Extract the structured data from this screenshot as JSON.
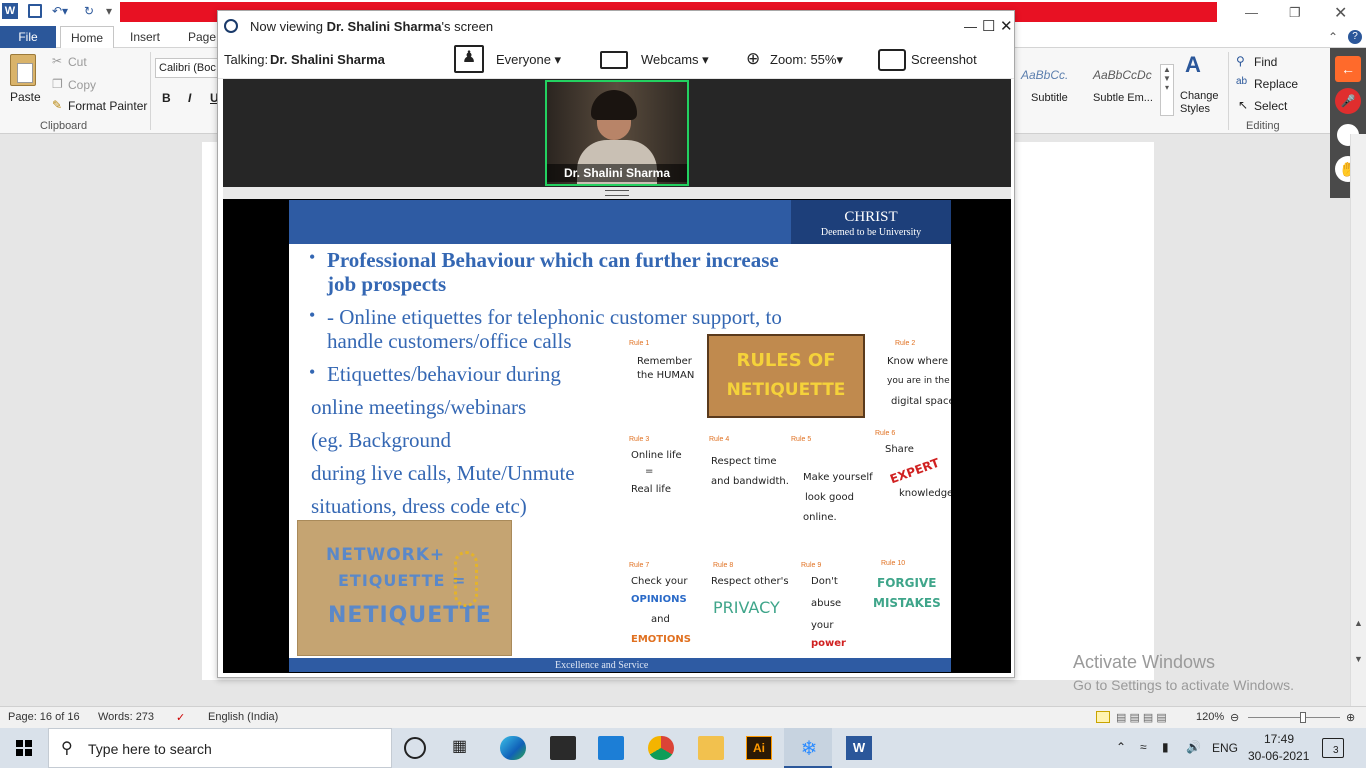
{
  "word": {
    "title_tab_file": "File",
    "tabs": [
      "Home",
      "Insert",
      "Page"
    ],
    "clipboard": {
      "paste": "Paste",
      "cut": "Cut",
      "copy": "Copy",
      "format_painter": "Format Painter",
      "group_label": "Clipboard"
    },
    "font_name": "Calibri (Boc",
    "styles": [
      {
        "preview": "AaBbCc.",
        "name": "Subtitle"
      },
      {
        "preview": "AaBbCcDc",
        "name": "Subtle Em..."
      }
    ],
    "change_styles": [
      "Change",
      "Styles"
    ],
    "editing": {
      "find": "Find",
      "replace": "Replace",
      "select": "Select",
      "group_label": "Editing"
    },
    "status": {
      "page": "Page: 16 of 16",
      "words": "Words: 273",
      "language": "English (India)",
      "zoom": "120%",
      "zoom_fraction": 0.6
    },
    "activate": {
      "line1": "Activate Windows",
      "line2": "Go to Settings to activate Windows."
    }
  },
  "zoom_window": {
    "title_prefix": "Now viewing ",
    "title_name": "Dr. Shalini  Sharma",
    "title_suffix": "'s screen",
    "talking_label": "Talking:",
    "talking_name": "Dr. Shalini  Sharma",
    "everyone": "Everyone",
    "webcams": "Webcams",
    "zoom_level": "Zoom: 55%",
    "screenshot": "Screenshot",
    "video_name": "Dr. Shalini  Sharma"
  },
  "slide": {
    "logo_name": "CHRIST",
    "logo_sub": "Deemed to be University",
    "bullets": [
      {
        "lines": [
          "Professional Behaviour which can further increase",
          "job prospects"
        ]
      },
      {
        "lines": [
          "- Online etiquettes for telephonic customer support, to",
          "handle customers/office calls"
        ]
      },
      {
        "lines": [
          "Etiquettes/behaviour during",
          "online meetings/webinars",
          "(eg. Background",
          "during live calls, Mute/Unmute",
          "situations, dress code etc)"
        ]
      }
    ],
    "netiquette_box": {
      "line1": "NETWORK+",
      "line2": "ETIQUETTE =",
      "line3": "NETIQUETTE"
    },
    "rules_title": [
      "RULES OF",
      "NETIQUETTE"
    ],
    "rules": [
      {
        "num": "Rule 1",
        "text": [
          "Remember",
          "the HUMAN"
        ]
      },
      {
        "num": "Rule 2",
        "text": [
          "Know where",
          "you are in the",
          "digital space."
        ]
      },
      {
        "num": "Rule 3",
        "text": [
          "Online life",
          "=",
          "Real life"
        ]
      },
      {
        "num": "Rule 4",
        "text": [
          "Respect time",
          "and bandwidth."
        ]
      },
      {
        "num": "Rule 5",
        "text": [
          "Make yourself",
          "look good",
          "online."
        ]
      },
      {
        "num": "Rule 6",
        "text": [
          "Share",
          "EXPERT",
          "knowledge."
        ]
      },
      {
        "num": "Rule 7",
        "text": [
          "Check your",
          "OPINIONS",
          "and",
          "EMOTIONS"
        ]
      },
      {
        "num": "Rule 8",
        "text": [
          "Respect other's",
          "PRIVACY"
        ]
      },
      {
        "num": "Rule 9",
        "text": [
          "Don't",
          "abuse",
          "your",
          "power"
        ]
      },
      {
        "num": "Rule 10",
        "text": [
          "FORGIVE",
          "MISTAKES"
        ]
      }
    ],
    "footer_text": "Excellence and Service"
  },
  "taskbar": {
    "search_placeholder": "Type here to search",
    "language": "ENG",
    "time": "17:49",
    "date": "30-06-2021",
    "notifications": "3",
    "icons": [
      "task-view-icon",
      "edge-icon",
      "store-icon",
      "mail-icon",
      "chrome-icon",
      "file-explorer-icon",
      "illustrator-icon",
      "zoom-app-icon",
      "word-app-icon"
    ]
  },
  "colors": {
    "word_blue": "#2b579a",
    "slide_blue": "#2e5ba3",
    "zoom_highlight": "#23d160",
    "red_bar": "#e81123"
  }
}
